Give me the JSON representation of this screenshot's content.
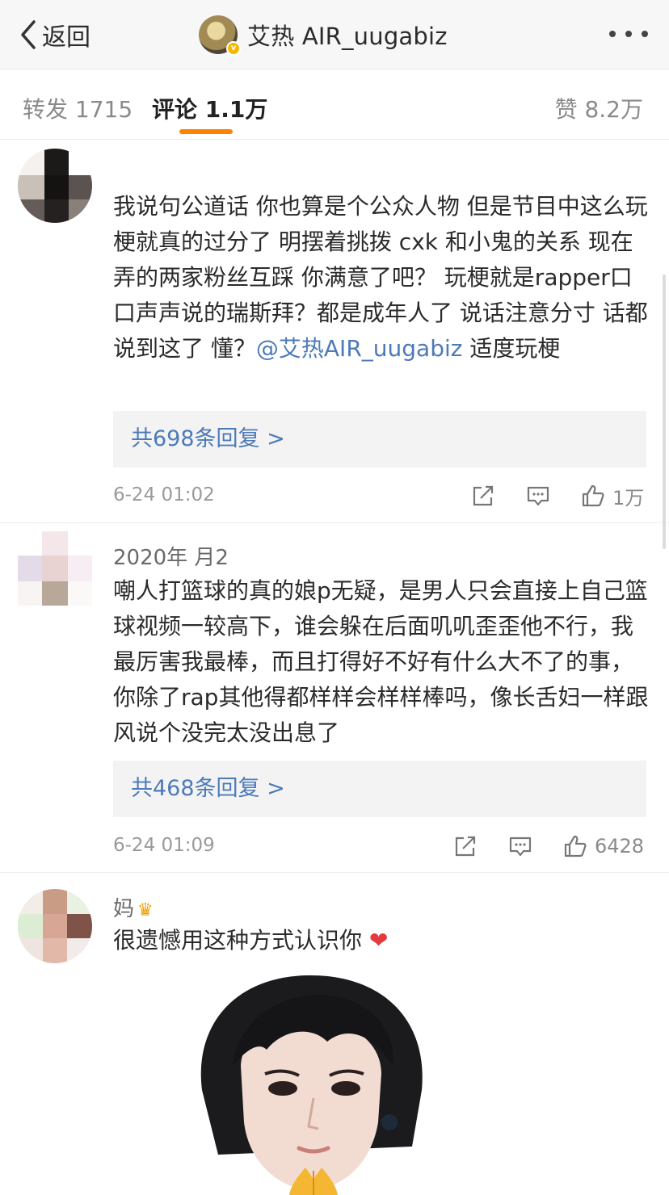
{
  "nav": {
    "back_label": "返回",
    "title": "艾热 AIR_uugabiz"
  },
  "tabs": {
    "repost": "转发 1715",
    "comment": "评论 1.1万",
    "likes": "赞 8.2万"
  },
  "comments": [
    {
      "name": "",
      "text_before_mention": "我说句公道话 你也算是个公众人物 但是节目中这么玩梗就真的过分了 明摆着挑拨 cxk 和小鬼的关系 现在弄的两家粉丝互踩 你满意了吧？ 玩梗就是rapper口口声声说的瑞斯拜？都是成年人了 说话注意分寸 话都说到这了 懂？",
      "mention": "@艾热AIR_uugabiz",
      "text_after_mention": " 适度玩梗",
      "replies": "共698条回复 >",
      "time": "6-24 01:02",
      "likes": "1万"
    },
    {
      "name": "2020年 月2",
      "text": "嘲人打篮球的真的娘p无疑，是男人只会直接上自己篮球视频一较高下，谁会躲在后面叽叽歪歪他不行，我最厉害我最棒，而且打得好不好有什么大不了的事，你除了rap其他得都样样会样样棒吗，像长舌妇一样跟风说个没完太没出息了",
      "replies": "共468条回复 >",
      "time": "6-24 01:09",
      "likes": "6428"
    },
    {
      "name": "妈",
      "text": "很遗憾用这种方式认识你",
      "emoji": "❤"
    }
  ],
  "colors": {
    "accent": "#ff8200",
    "link": "#4d7ab8",
    "verified": "#f5b700"
  }
}
